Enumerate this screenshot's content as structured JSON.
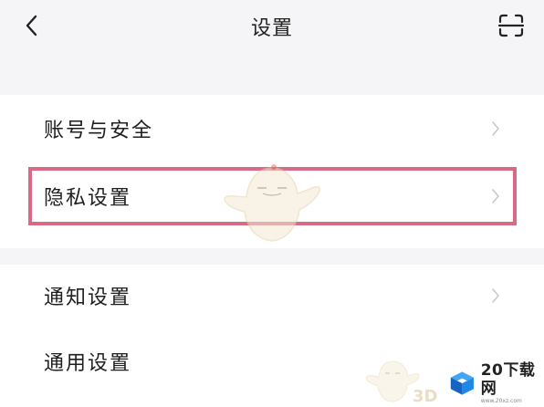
{
  "header": {
    "title": "设置",
    "back_icon": "chevron-left-icon",
    "scan_icon": "scan-icon"
  },
  "settings": {
    "groups": [
      {
        "items": [
          {
            "label": "账号与安全",
            "icon": "chevron-right-icon"
          },
          {
            "label": "隐私设置",
            "icon": "chevron-right-icon",
            "highlighted": true
          }
        ]
      },
      {
        "items": [
          {
            "label": "通知设置",
            "icon": "chevron-right-icon"
          },
          {
            "label": "通用设置",
            "icon": "chevron-right-icon"
          }
        ]
      }
    ]
  },
  "watermark": {
    "brand": "20下载网",
    "url": "www.20xz.com",
    "mascot_text": "3D"
  },
  "colors": {
    "background": "#f5f5f7",
    "card": "#ffffff",
    "highlight_border": "#d96a86",
    "chevron": "#c8c8c8",
    "watermark_blue": "#1565c0"
  }
}
